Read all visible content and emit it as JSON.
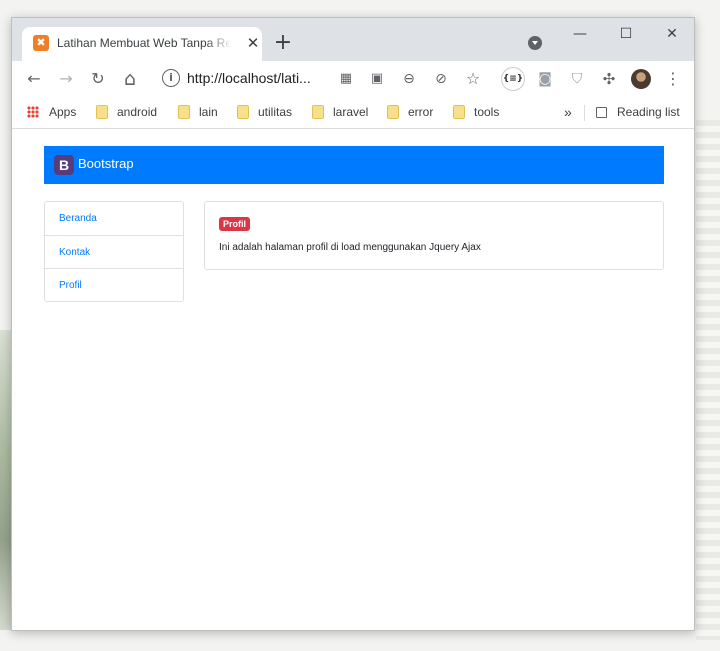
{
  "browser": {
    "tab": {
      "favicon": "xampp-icon",
      "title": "Latihan Membuat Web Tanpa Reload",
      "close": "✕"
    },
    "new_tab": "+",
    "window_controls": {
      "minimize": "—",
      "maximize": "☐",
      "close": "✕"
    },
    "toolbar": {
      "back": "←",
      "forward": "→",
      "reload": "↻",
      "home": "⌂",
      "info": "i",
      "url": "http://localhost/lati...",
      "ext_badge": "{≡}"
    },
    "bookmarks": {
      "apps": "Apps",
      "folders": [
        "android",
        "lain",
        "utilitas",
        "laravel",
        "error",
        "tools"
      ],
      "overflow": "»",
      "reading_list": "Reading list"
    }
  },
  "page": {
    "brand": {
      "logo": "B",
      "text": "Bootstrap"
    },
    "menu": [
      "Beranda",
      "Kontak",
      "Profil"
    ],
    "content": {
      "badge": "Profil",
      "text": "Ini adalah halaman profil di load menggunakan Jquery Ajax"
    }
  },
  "colors": {
    "primary": "#007bff",
    "danger": "#dc3545",
    "brand_purple": "#563d7c"
  }
}
